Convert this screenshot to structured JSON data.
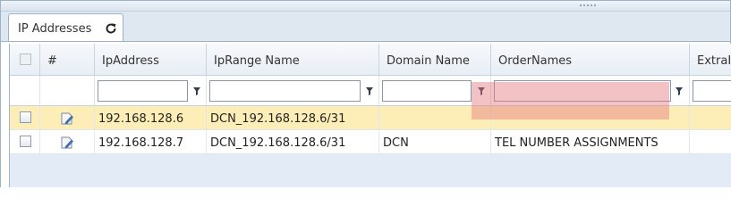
{
  "tab": {
    "label": "IP Addresses",
    "refresh_icon": "refresh-icon"
  },
  "columns": {
    "number": "#",
    "ip_address": "IpAddress",
    "ip_range_name": "IpRange Name",
    "domain_name": "Domain Name",
    "order_names": "OrderNames",
    "extra": "ExtraI"
  },
  "filters": {
    "ip_address": "",
    "ip_range_name": "",
    "domain_name": "",
    "order_names": "",
    "extra": ""
  },
  "rows": [
    {
      "selected": true,
      "ip_address": "192.168.128.6",
      "ip_range_name": "DCN_192.168.128.6/31",
      "domain_name": "",
      "order_names": ""
    },
    {
      "selected": false,
      "ip_address": "192.168.128.7",
      "ip_range_name": "DCN_192.168.128.6/31",
      "domain_name": "DCN",
      "order_names": "TEL NUMBER ASSIGNMENTS"
    }
  ],
  "colors": {
    "selected_row": "#fdeeb7",
    "highlight": "#e4787d",
    "border": "#9fb3c8"
  }
}
